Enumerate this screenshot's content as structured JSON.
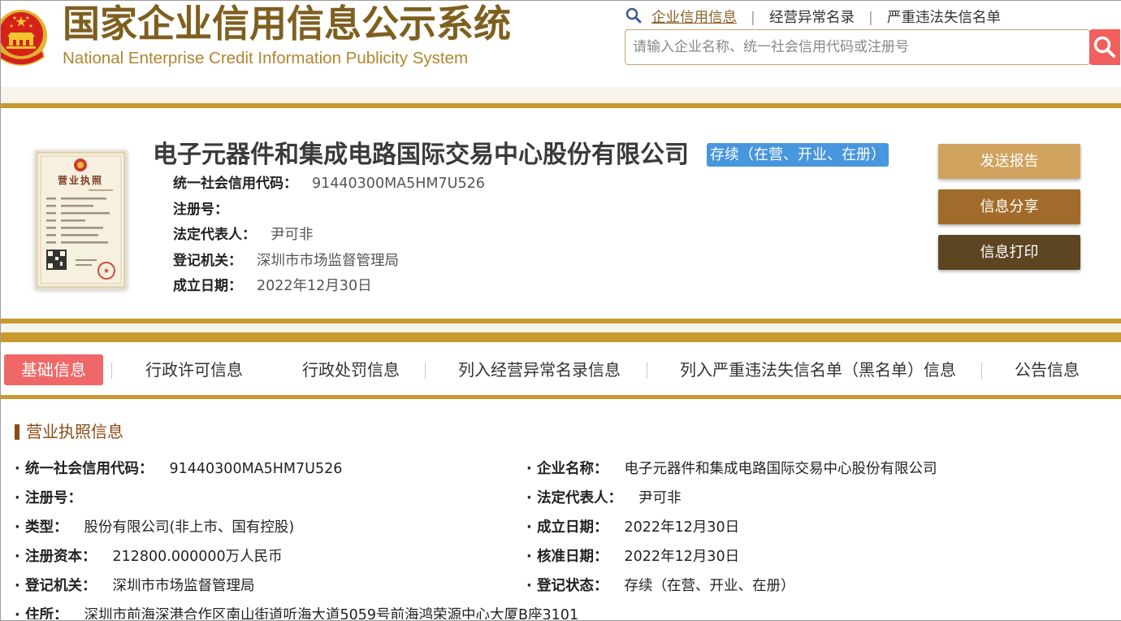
{
  "header": {
    "title": "国家企业信用信息公示系统",
    "subtitle": "National Enterprise Credit Information Publicity System",
    "emblem_icon": "national-emblem-icon",
    "nav_icon": "search-icon",
    "nav": [
      {
        "label": "企业信用信息",
        "active": true
      },
      {
        "label": "经营异常名录",
        "active": false
      },
      {
        "label": "严重违法失信名单",
        "active": false
      }
    ],
    "nav_separator": "|",
    "search": {
      "placeholder": "请输入企业名称、统一社会信用代码或注册号",
      "value": "",
      "button_icon": "search-icon"
    }
  },
  "company": {
    "name": "电子元器件和集成电路国际交易中心股份有限公司",
    "status_badge": "存续（在营、开业、在册）",
    "license_thumbnail": {
      "icon": "business-license-image",
      "heading": "营业执照"
    },
    "fields": [
      {
        "label": "统一社会信用代码：",
        "value": "91440300MA5HM7U526"
      },
      {
        "label": "注册号："
      },
      {
        "label": "法定代表人：",
        "value": "尹可非"
      },
      {
        "label": "登记机关：",
        "value": "深圳市市场监督管理局"
      },
      {
        "label": "成立日期：",
        "value": "2022年12月30日"
      }
    ],
    "actions": [
      {
        "label": "发送报告"
      },
      {
        "label": "信息分享"
      },
      {
        "label": "信息打印"
      }
    ]
  },
  "tabs": [
    {
      "label": "基础信息",
      "active": true
    },
    {
      "label": "行政许可信息",
      "active": false
    },
    {
      "label": "行政处罚信息",
      "active": false
    },
    {
      "label": "列入经营异常名录信息",
      "active": false
    },
    {
      "label": "列入严重违法失信名单（黑名单）信息",
      "active": false
    },
    {
      "label": "公告信息",
      "active": false
    }
  ],
  "license_section": {
    "title": "营业执照信息",
    "bullet": "·",
    "left": [
      {
        "label": "统一社会信用代码：",
        "value": "91440300MA5HM7U526"
      },
      {
        "label": "注册号："
      },
      {
        "label": "类型：",
        "value": "股份有限公司(非上市、国有控股)"
      },
      {
        "label": "注册资本：",
        "value": "212800.000000万人民币"
      },
      {
        "label": "登记机关：",
        "value": "深圳市市场监督管理局"
      },
      {
        "label": "住所：",
        "value": "深圳市前海深港合作区南山街道听海大道5059号前海鸿荣源中心大厦B座3101"
      }
    ],
    "right": [
      {
        "label": "企业名称：",
        "value": "电子元器件和集成电路国际交易中心股份有限公司"
      },
      {
        "label": "法定代表人：",
        "value": "尹可非"
      },
      {
        "label": "成立日期：",
        "value": "2022年12月30日"
      },
      {
        "label": "核准日期：",
        "value": "2022年12月30日"
      },
      {
        "label": "登记状态：",
        "value": "存续（在营、开业、在册）"
      }
    ]
  },
  "colors": {
    "brand_gold": "#c8992f",
    "strip_beige": "#f8f3eb",
    "title_brown": "#7f5f1e",
    "subtitle_gold": "#b3842e",
    "nav_active": "#8a6328",
    "search_border": "#c8a36a",
    "search_button": "#f25f5c",
    "badge_blue": "#4796de",
    "button_send": "#cfa25d",
    "button_share": "#a16c2b",
    "button_print": "#5c4520",
    "tab_active": "#f06767",
    "section_brown": "#8a4b14"
  }
}
